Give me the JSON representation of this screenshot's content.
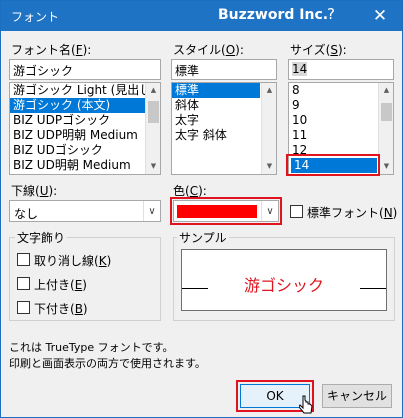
{
  "window": {
    "title": "フォント",
    "brand": "Buzzword Inc.",
    "help_label": "?",
    "close_label": "✕"
  },
  "font_name": {
    "label_text": "フォント名(",
    "label_key": "F",
    "label_end": "):",
    "value": "游ゴシック",
    "items": [
      "游ゴシック Light (見出し)",
      "游ゴシック (本文)",
      "BIZ UDPゴシック",
      "BIZ UDP明朝 Medium",
      "BIZ UDゴシック",
      "BIZ UD明朝 Medium"
    ],
    "selected_index": 1
  },
  "style": {
    "label_text": "スタイル(",
    "label_key": "O",
    "label_end": "):",
    "value": "標準",
    "items": [
      "標準",
      "斜体",
      "太字",
      "太字 斜体"
    ],
    "selected_index": 0
  },
  "size": {
    "label_text": "サイズ(",
    "label_key": "S",
    "label_end": "):",
    "value": "14",
    "items": [
      "8",
      "9",
      "10",
      "11",
      "12",
      "14"
    ],
    "selected_index": 5
  },
  "underline": {
    "label_text": "下線(",
    "label_key": "U",
    "label_end": "):",
    "value": "なし"
  },
  "color": {
    "label_text": "色(",
    "label_key": "C",
    "label_end": "):",
    "swatch": "#ff0000"
  },
  "normal_font": {
    "label_text": "標準フォント(",
    "label_key": "N",
    "label_end": ")"
  },
  "effects": {
    "title": "文字飾り",
    "strike": {
      "text": "取り消し線(",
      "key": "K",
      "end": ")"
    },
    "super": {
      "text": "上付き(",
      "key": "E",
      "end": ")"
    },
    "sub": {
      "text": "下付き(",
      "key": "B",
      "end": ")"
    }
  },
  "sample": {
    "title": "サンプル",
    "text": "游ゴシック",
    "text_color": "#e0141e"
  },
  "info": {
    "line1": "これは TrueType フォントです。",
    "line2": "印刷と画面表示の両方で使用されます。"
  },
  "buttons": {
    "ok": "OK",
    "cancel": "キャンセル"
  },
  "accent": "#0078d7",
  "highlight": "#e0141e"
}
